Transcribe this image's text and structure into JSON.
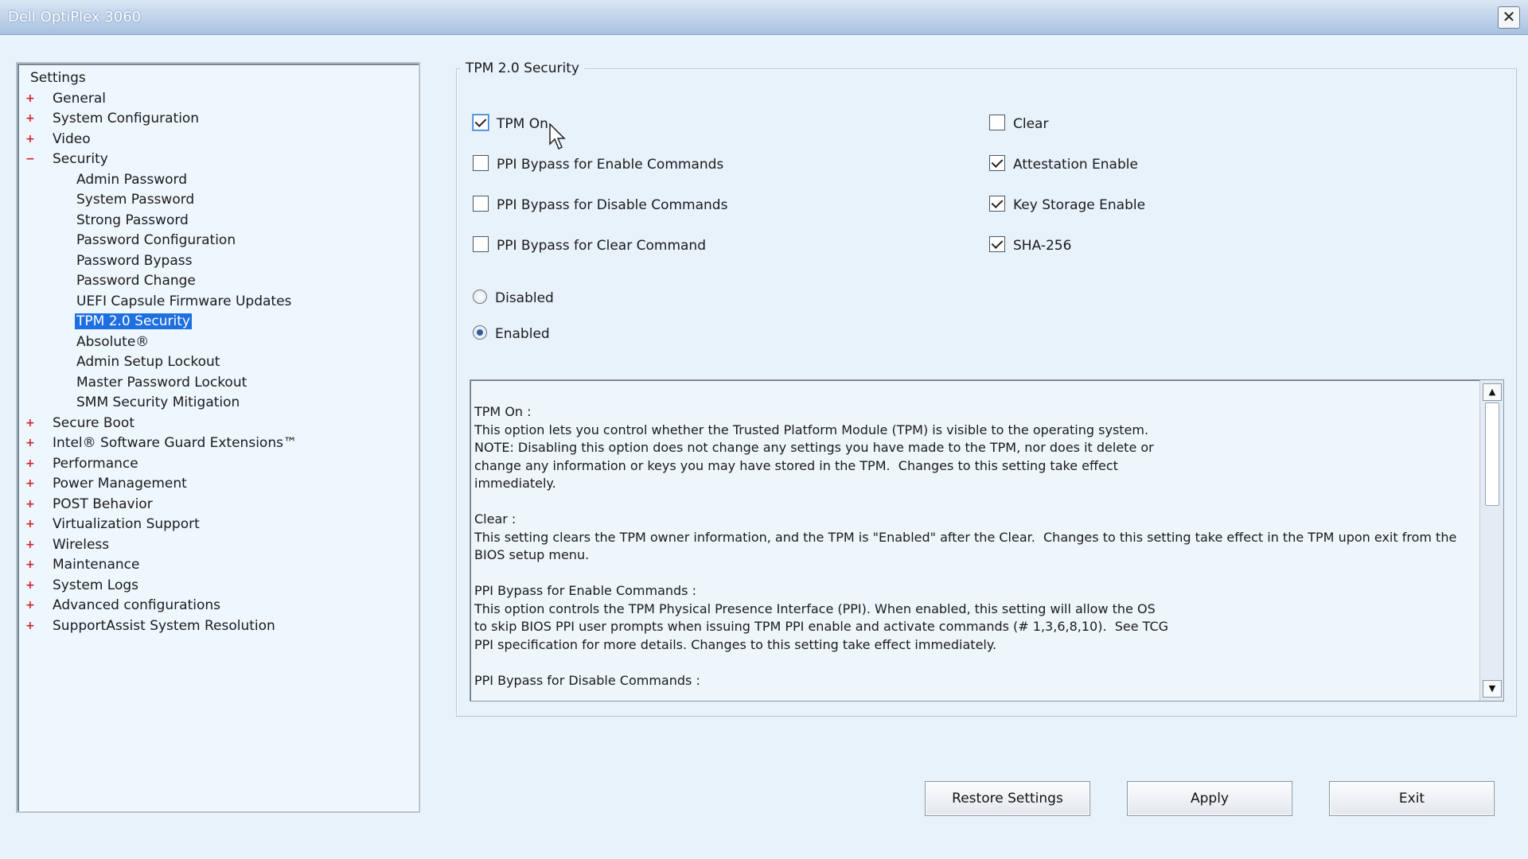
{
  "window": {
    "title": "Dell OptiPlex 3060",
    "close_glyph": "✕"
  },
  "tree": {
    "root": "Settings",
    "categories_before": [
      {
        "label": "General",
        "expander": "+"
      },
      {
        "label": "System Configuration",
        "expander": "+"
      },
      {
        "label": "Video",
        "expander": "+"
      },
      {
        "label": "Security",
        "expander": "−"
      }
    ],
    "security_items": [
      "Admin Password",
      "System Password",
      "Strong Password",
      "Password Configuration",
      "Password Bypass",
      "Password Change",
      "UEFI Capsule Firmware Updates",
      "TPM 2.0 Security",
      "Absolute®",
      "Admin Setup Lockout",
      "Master Password Lockout",
      "SMM Security Mitigation"
    ],
    "selected_item": "TPM 2.0 Security",
    "categories_after": [
      "Secure Boot",
      "Intel® Software Guard Extensions™",
      "Performance",
      "Power Management",
      "POST Behavior",
      "Virtualization Support",
      "Wireless",
      "Maintenance",
      "System Logs",
      "Advanced configurations",
      "SupportAssist System Resolution"
    ]
  },
  "group": {
    "title": "TPM 2.0 Security",
    "left_checkboxes": [
      {
        "label": "TPM On",
        "checked": true
      },
      {
        "label": "PPI Bypass for Enable Commands",
        "checked": false
      },
      {
        "label": "PPI Bypass for Disable Commands",
        "checked": false
      },
      {
        "label": "PPI Bypass for Clear Command",
        "checked": false
      }
    ],
    "right_checkboxes": [
      {
        "label": "Clear",
        "checked": false
      },
      {
        "label": "Attestation Enable",
        "checked": true
      },
      {
        "label": "Key Storage Enable",
        "checked": true
      },
      {
        "label": "SHA-256",
        "checked": true
      }
    ],
    "radios": [
      {
        "label": "Disabled",
        "selected": false
      },
      {
        "label": "Enabled",
        "selected": true
      }
    ]
  },
  "description": {
    "text": "TPM On :\nThis option lets you control whether the Trusted Platform Module (TPM) is visible to the operating system.\nNOTE: Disabling this option does not change any settings you have made to the TPM, nor does it delete or\nchange any information or keys you may have stored in the TPM.  Changes to this setting take effect\nimmediately.\n\nClear :\nThis setting clears the TPM owner information, and the TPM is \"Enabled\" after the Clear.  Changes to this setting take effect in the TPM upon exit from the\nBIOS setup menu.\n\nPPI Bypass for Enable Commands :\nThis option controls the TPM Physical Presence Interface (PPI). When enabled, this setting will allow the OS\nto skip BIOS PPI user prompts when issuing TPM PPI enable and activate commands (# 1,3,6,8,10).  See TCG\nPPI specification for more details. Changes to this setting take effect immediately.\n\nPPI Bypass for Disable Commands :",
    "scroll_up": "▲",
    "scroll_down": "▼"
  },
  "buttons": {
    "restore": "Restore Settings",
    "apply": "Apply",
    "exit": "Exit"
  }
}
